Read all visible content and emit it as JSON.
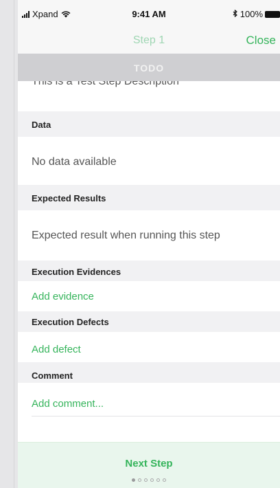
{
  "status_bar": {
    "carrier": "Xpand",
    "time": "9:41 AM",
    "battery_text": "100%",
    "icons": [
      "signal-icon",
      "wifi-icon",
      "bluetooth-icon",
      "battery-icon"
    ]
  },
  "nav": {
    "title": "Step 1",
    "close_label": "Close"
  },
  "banner": {
    "status": "TODO"
  },
  "step": {
    "description": "This is a Test Step Description"
  },
  "sections": {
    "data": {
      "header": "Data",
      "value": "No data available"
    },
    "expected": {
      "header": "Expected Results",
      "value": "Expected result when running this step"
    },
    "evidences": {
      "header": "Execution Evidences",
      "action": "Add evidence"
    },
    "defects": {
      "header": "Execution Defects",
      "action": "Add defect"
    },
    "comment": {
      "header": "Comment",
      "action": "Add comment..."
    }
  },
  "footer": {
    "next_label": "Next Step",
    "page_count": 6,
    "current_page": 1
  },
  "colors": {
    "accent": "#35b45b",
    "banner": "#cfcfd2",
    "section_header_bg": "#f1f1f3",
    "footer_bg": "#e9f6ed"
  }
}
